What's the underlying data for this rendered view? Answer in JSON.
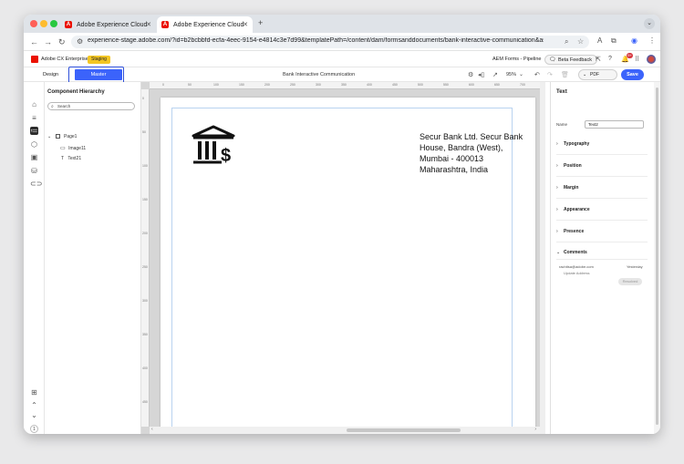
{
  "browser": {
    "tabs": [
      {
        "title": "Adobe Experience Cloud",
        "active": false
      },
      {
        "title": "Adobe Experience Cloud",
        "active": true
      }
    ],
    "url": "experience-stage.adobe.com/?id=b2bcbbfd-ecfa-4eec-9154-e4814c3e7d99&templatePath=/content/dam/formsanddocuments/bank-interactive-communication&asset..."
  },
  "header": {
    "app_name": "Adobe CX Enterprise",
    "env_badge": "Staging",
    "org": "AEM Forms - Pipeline",
    "beta_feedback": "Beta Feedback",
    "notification_count": "9+"
  },
  "toolbar": {
    "design_label": "Design",
    "master_label": "Master",
    "document_title": "Bank Interactive Communication",
    "zoom": "95%",
    "pdf_preview": "PDF Preview",
    "save_label": "Save"
  },
  "hierarchy": {
    "title": "Component Hierarchy",
    "search_placeholder": "Search",
    "nodes": {
      "page": "Page1",
      "image": "Image11",
      "text": "Text21"
    }
  },
  "rail_pages": {
    "current": "1",
    "total": "1"
  },
  "document": {
    "address": "Secur Bank Ltd. Secur Bank House, Bandra (West), Mumbai - 400013 Maharashtra, India"
  },
  "properties": {
    "title": "Text",
    "name_label": "Name",
    "name_value": "Text2",
    "sections": [
      "Typography",
      "Position",
      "Margin",
      "Appearance",
      "Presence",
      "Comments"
    ],
    "comment": {
      "email": "rachitsa@adobe.com",
      "time": "Yesterday",
      "text": "Update Address",
      "resolve_label": "Resolved"
    }
  },
  "ruler": {
    "h_ticks": [
      "0",
      "50",
      "100",
      "150",
      "200",
      "250",
      "300",
      "350",
      "400",
      "450",
      "500",
      "550",
      "600",
      "650",
      "700"
    ],
    "v_ticks": [
      "0",
      "50",
      "100",
      "150",
      "200",
      "250",
      "300",
      "350",
      "400",
      "450"
    ]
  }
}
